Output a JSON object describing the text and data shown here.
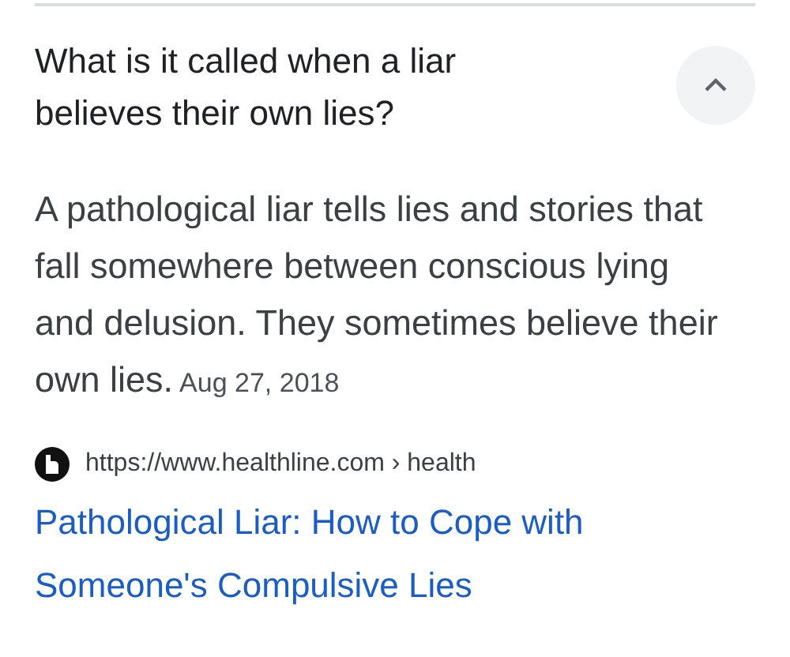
{
  "question": {
    "text": "What is it called when a liar believes their own lies?",
    "expanded": true
  },
  "answer": {
    "text": "A pathological liar tells lies and stories that fall somewhere between conscious lying and delusion. They sometimes believe their own lies.",
    "date": "Aug 27, 2018"
  },
  "source": {
    "url": "https://www.healthline.com › health",
    "title": "Pathological Liar: How to Cope with Someone's Compulsive Lies"
  }
}
